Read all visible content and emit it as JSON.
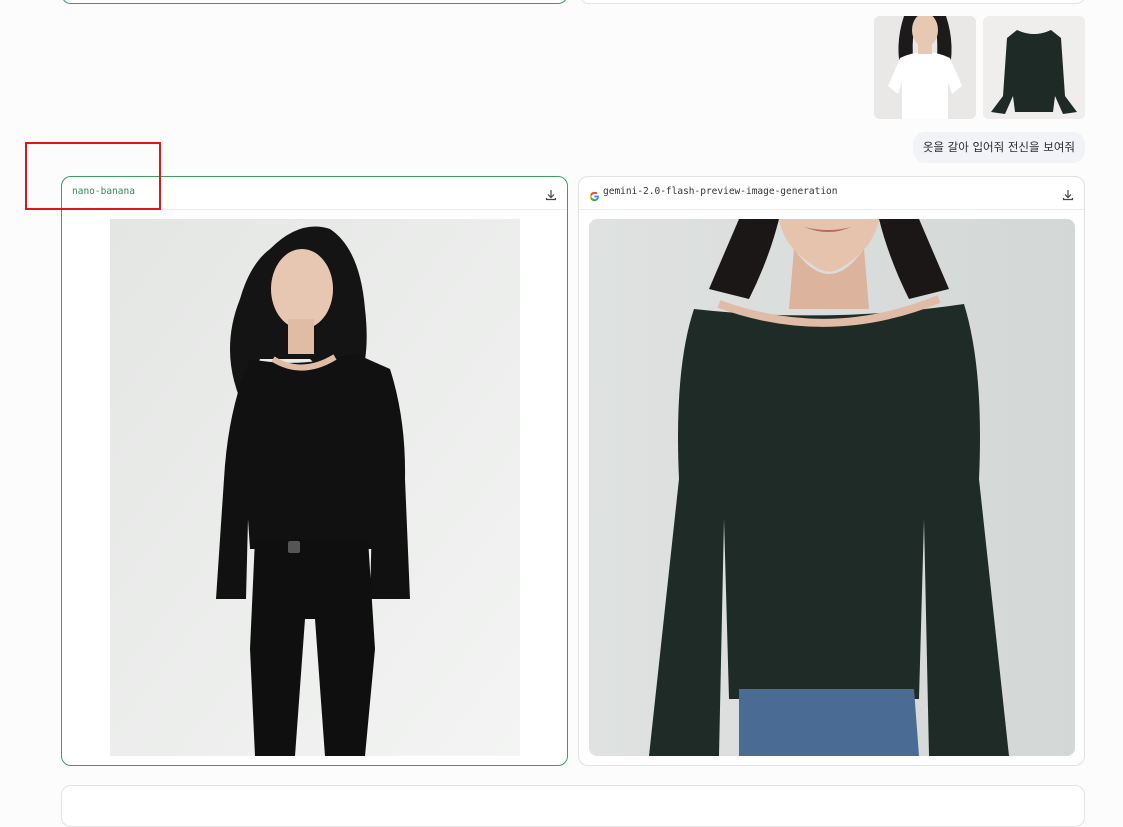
{
  "user_message": {
    "text": "옷을 갈아 입어줘 전신을 보여줘"
  },
  "attachments": [
    {
      "icon": "woman-white-tshirt-photo"
    },
    {
      "icon": "dark-green-bell-sleeve-top-photo"
    }
  ],
  "responses": [
    {
      "model": "nano-banana",
      "winner": true,
      "image": "woman-black-top-jeans-full-body"
    },
    {
      "model": "gemini-2.0-flash-preview-image-generation",
      "winner": false,
      "image": "dark-green-top-cropped-torso"
    }
  ],
  "colors": {
    "winner_border": "#3f9b63",
    "winner_label": "#2e8b57",
    "annotation": "#e0161b"
  }
}
